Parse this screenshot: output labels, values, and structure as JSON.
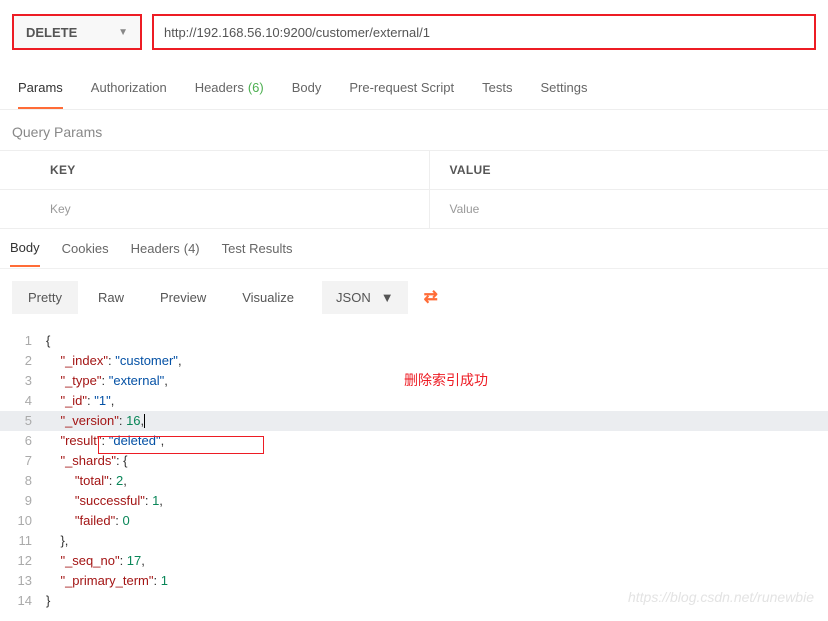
{
  "request": {
    "method": "DELETE",
    "url": "http://192.168.56.10:9200/customer/external/1"
  },
  "tabs": {
    "params": "Params",
    "authorization": "Authorization",
    "headers": "Headers",
    "headers_count": "(6)",
    "body": "Body",
    "pre_request": "Pre-request Script",
    "tests": "Tests",
    "settings": "Settings"
  },
  "params_section": {
    "title": "Query Params",
    "key_header": "KEY",
    "value_header": "VALUE",
    "key_placeholder": "Key",
    "value_placeholder": "Value"
  },
  "response_tabs": {
    "body": "Body",
    "cookies": "Cookies",
    "headers": "Headers",
    "headers_count": "(4)",
    "test_results": "Test Results"
  },
  "view_bar": {
    "pretty": "Pretty",
    "raw": "Raw",
    "preview": "Preview",
    "visualize": "Visualize",
    "fmt": "JSON"
  },
  "response_json": {
    "_index": "customer",
    "_type": "external",
    "_id": "1",
    "_version": 16,
    "result": "deleted",
    "_shards": {
      "total": 2,
      "successful": 1,
      "failed": 0
    },
    "_seq_no": 17,
    "_primary_term": 1
  },
  "annotation": "删除索引成功",
  "watermark": "https://blog.csdn.net/runewbie"
}
